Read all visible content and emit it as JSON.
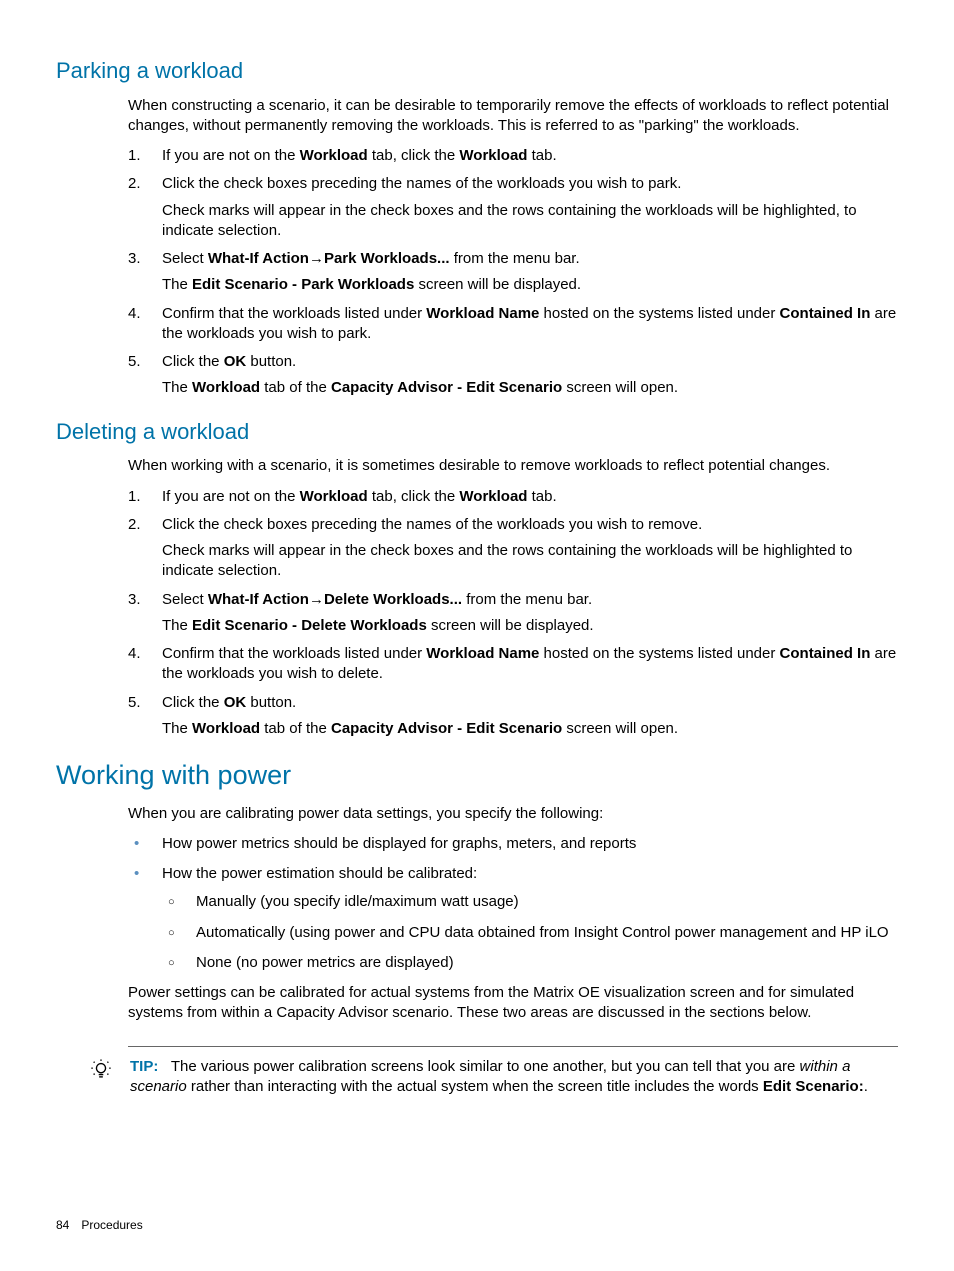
{
  "section1": {
    "title": "Parking a workload",
    "intro": "When constructing a scenario, it can be desirable to temporarily remove the effects of workloads to reflect potential changes, without permanently removing the workloads. This is referred to as \"parking\" the workloads.",
    "steps": {
      "s1a": "If you are not on the ",
      "s1b": "Workload",
      "s1c": " tab, click the ",
      "s1d": "Workload",
      "s1e": " tab.",
      "s2": "Click the check boxes preceding the names of the workloads you wish to park.",
      "s2sub": "Check marks will appear in the check boxes and the rows containing the workloads will be highlighted, to indicate selection.",
      "s3a": "Select ",
      "s3b": "What-If Action",
      "s3arrow": "→",
      "s3c": "Park Workloads...",
      "s3d": " from the menu bar.",
      "s3suba": "The ",
      "s3subb": "Edit Scenario - Park Workloads",
      "s3subc": " screen will be displayed.",
      "s4a": "Confirm that the workloads listed under ",
      "s4b": "Workload Name",
      "s4c": " hosted on the systems listed under ",
      "s4d": "Contained In",
      "s4e": " are the workloads you wish to park.",
      "s5a": "Click the ",
      "s5b": "OK",
      "s5c": " button.",
      "s5suba": "The ",
      "s5subb": "Workload",
      "s5subc": " tab of the ",
      "s5subd": "Capacity Advisor - Edit Scenario",
      "s5sube": " screen will open."
    }
  },
  "section2": {
    "title": "Deleting a workload",
    "intro": "When working with a scenario, it is sometimes desirable to remove workloads to reflect potential changes.",
    "steps": {
      "s1a": "If you are not on the ",
      "s1b": "Workload",
      "s1c": " tab, click the ",
      "s1d": "Workload",
      "s1e": " tab.",
      "s2": "Click the check boxes preceding the names of the workloads you wish to remove.",
      "s2sub": "Check marks will appear in the check boxes and the rows containing the workloads will be highlighted to indicate selection.",
      "s3a": "Select ",
      "s3b": "What-If Action",
      "s3arrow": "→",
      "s3c": "Delete Workloads...",
      "s3d": " from the menu bar.",
      "s3suba": "The ",
      "s3subb": "Edit Scenario - Delete Workloads",
      "s3subc": " screen will be displayed.",
      "s4a": "Confirm that the workloads listed under ",
      "s4b": "Workload Name",
      "s4c": " hosted on the systems listed under ",
      "s4d": "Contained In",
      "s4e": " are the workloads you wish to delete.",
      "s5a": "Click the ",
      "s5b": "OK",
      "s5c": " button.",
      "s5suba": "The ",
      "s5subb": "Workload",
      "s5subc": " tab of the ",
      "s5subd": "Capacity Advisor - Edit Scenario",
      "s5sube": " screen will open."
    }
  },
  "section3": {
    "title": "Working with power",
    "intro": "When you are calibrating power data settings, you specify the following:",
    "bullets": {
      "b1": "How power metrics should be displayed for graphs, meters, and reports",
      "b2": "How the power estimation should be calibrated:",
      "b2a": "Manually (you specify idle/maximum watt usage)",
      "b2b": "Automatically (using power and CPU data obtained from Insight Control power management and HP iLO",
      "b2c": "None (no power metrics are displayed)"
    },
    "outro": "Power settings can be calibrated for actual systems from the Matrix OE visualization screen and for simulated systems from within a Capacity Advisor scenario. These two areas are discussed in the sections below.",
    "tip": {
      "label": "TIP:",
      "t1": "The various power calibration screens look similar to one another, but you can tell that you are ",
      "t2": " within a scenario",
      "t3": " rather than interacting with the actual system when the screen title includes the words ",
      "t4": "Edit Scenario:",
      "t5": "."
    }
  },
  "footer": {
    "pageno": "84",
    "section": "Procedures"
  }
}
